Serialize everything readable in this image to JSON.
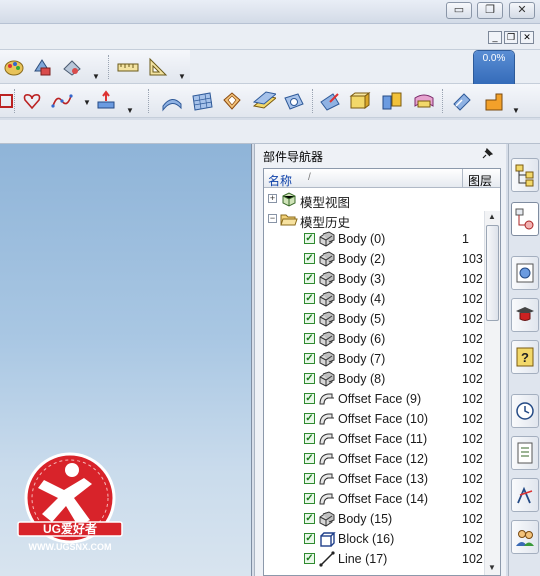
{
  "window": {
    "minimize_glyph": "▭",
    "restore_glyph": "❐",
    "close_glyph": "✕"
  },
  "mdi": {
    "minimize_glyph": "_",
    "restore_glyph": "❐",
    "close_glyph": "✕"
  },
  "progress": {
    "value": "0.0%",
    "fraction": 0.0
  },
  "navigator": {
    "title": "部件导航器",
    "column_name": "名称",
    "column_layer": "图层",
    "sort_glyph": "/",
    "groups": [
      {
        "label": "模型视图",
        "expanded": false
      },
      {
        "label": "模型历史",
        "expanded": true
      }
    ],
    "features": [
      {
        "label": "Body (0)",
        "layer": "1",
        "icon": "body-icon"
      },
      {
        "label": "Body (2)",
        "layer": "103",
        "icon": "body-icon"
      },
      {
        "label": "Body (3)",
        "layer": "102",
        "icon": "body-icon"
      },
      {
        "label": "Body (4)",
        "layer": "102",
        "icon": "body-icon"
      },
      {
        "label": "Body (5)",
        "layer": "102",
        "icon": "body-icon"
      },
      {
        "label": "Body (6)",
        "layer": "102",
        "icon": "body-icon"
      },
      {
        "label": "Body (7)",
        "layer": "102",
        "icon": "body-icon"
      },
      {
        "label": "Body (8)",
        "layer": "102",
        "icon": "body-icon"
      },
      {
        "label": "Offset Face (9)",
        "layer": "102",
        "icon": "offset-face-icon"
      },
      {
        "label": "Offset Face (10)",
        "layer": "102",
        "icon": "offset-face-icon"
      },
      {
        "label": "Offset Face (11)",
        "layer": "102",
        "icon": "offset-face-icon"
      },
      {
        "label": "Offset Face (12)",
        "layer": "102",
        "icon": "offset-face-icon"
      },
      {
        "label": "Offset Face (13)",
        "layer": "102",
        "icon": "offset-face-icon"
      },
      {
        "label": "Offset Face (14)",
        "layer": "102",
        "icon": "offset-face-icon"
      },
      {
        "label": "Body (15)",
        "layer": "102",
        "icon": "body-icon"
      },
      {
        "label": "Block (16)",
        "layer": "102",
        "icon": "block-icon"
      },
      {
        "label": "Line (17)",
        "layer": "102",
        "icon": "line-icon"
      }
    ]
  },
  "logo": {
    "brand": "UG爱好者",
    "url": "WWW.UGSNX.COM"
  },
  "colors": {
    "accent": "#2f66b5",
    "check": "#1c7d1c",
    "logo_red": "#d8232a"
  }
}
